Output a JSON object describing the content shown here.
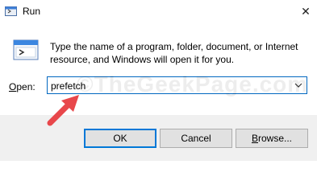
{
  "window": {
    "title": "Run",
    "close_glyph": "✕"
  },
  "dialog": {
    "description": "Type the name of a program, folder, document, or Internet resource, and Windows will open it for you.",
    "open_label_accel": "O",
    "open_label_rest": "pen:",
    "input_value": "prefetch",
    "watermark": "©TheGeekPage.com"
  },
  "buttons": {
    "ok": "OK",
    "cancel": "Cancel",
    "browse_accel": "B",
    "browse_rest": "rowse..."
  },
  "colors": {
    "accent": "#0078d7",
    "arrow": "#e8474b",
    "footer_bg": "#f0f0f0"
  },
  "icons": [
    "run-icon",
    "close-icon",
    "run-app-icon",
    "dropdown-caret-icon",
    "pointer-arrow-icon"
  ]
}
